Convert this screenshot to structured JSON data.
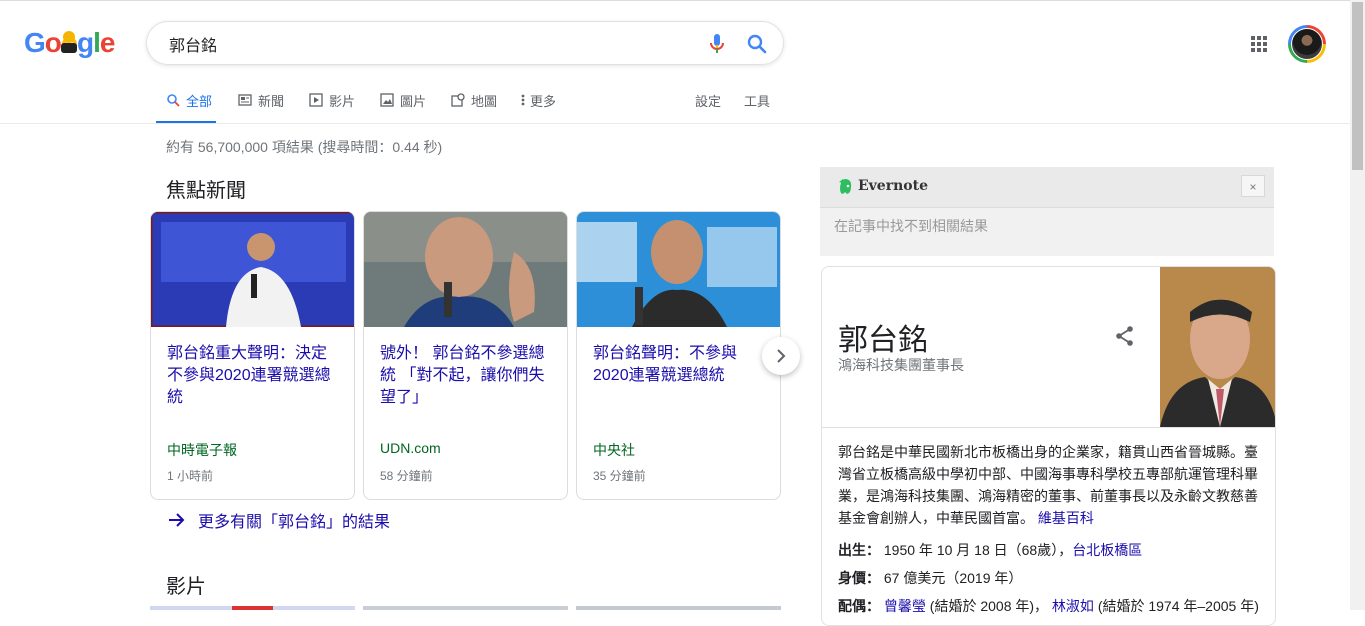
{
  "logo": {
    "text": "Google"
  },
  "search": {
    "query": "郭台銘"
  },
  "tabs": [
    {
      "label": "全部",
      "icon": "search-icon"
    },
    {
      "label": "新聞",
      "icon": "news-icon"
    },
    {
      "label": "影片",
      "icon": "video-icon"
    },
    {
      "label": "圖片",
      "icon": "image-icon"
    },
    {
      "label": "地圖",
      "icon": "map-icon"
    },
    {
      "label": "更多",
      "icon": "more-vert-icon"
    }
  ],
  "tools": {
    "settings": "設定",
    "tools": "工具"
  },
  "result_stats": "約有 56,700,000 項結果 (搜尋時間：0.44 秒)",
  "top_stories": {
    "heading": "焦點新聞",
    "cards": [
      {
        "title": "郭台銘重大聲明：決定不參與2020連署競選總統",
        "source": "中時電子報",
        "time": "1 小時前"
      },
      {
        "title": "號外！ 郭台銘不參選總統 「對不起，讓你們失望了」",
        "source": "UDN.com",
        "time": "58 分鐘前"
      },
      {
        "title": "郭台銘聲明：不參與2020連署競選總統",
        "source": "中央社",
        "time": "35 分鐘前"
      }
    ],
    "more_link": "更多有關「郭台銘」的結果"
  },
  "videos": {
    "heading": "影片"
  },
  "evernote": {
    "name": "Evernote",
    "close": "×",
    "message": "在記事中找不到相關結果"
  },
  "knowledge_panel": {
    "name": "郭台銘",
    "subtitle": "鴻海科技集團董事長",
    "description": "郭台銘是中華民國新北市板橋出身的企業家，籍貫山西省晉城縣。臺灣省立板橋高級中學初中部、中國海事專科學校五專部航運管理科畢業，是鴻海科技集團、鴻海精密的董事、前董事長以及永齡文教慈善基金會創辦人，中華民國首富。",
    "description_link": "維基百科",
    "facts": {
      "born_label": "出生：",
      "born_value": "1950 年 10 月 18 日（68歲），",
      "born_link": "台北板橋區",
      "networth_label": "身價：",
      "networth_value": "67 億美元（2019 年）",
      "spouse_label": "配偶：",
      "spouse1_link": "曾馨瑩",
      "spouse1_note": "(結婚於 2008 年)，",
      "spouse2_link": "林淑如",
      "spouse2_note": "(結婚於 1974 年–2005 年)"
    }
  },
  "colors": {
    "link": "#1a0dab",
    "source_green": "#006621",
    "accent_blue": "#1a73e8"
  }
}
